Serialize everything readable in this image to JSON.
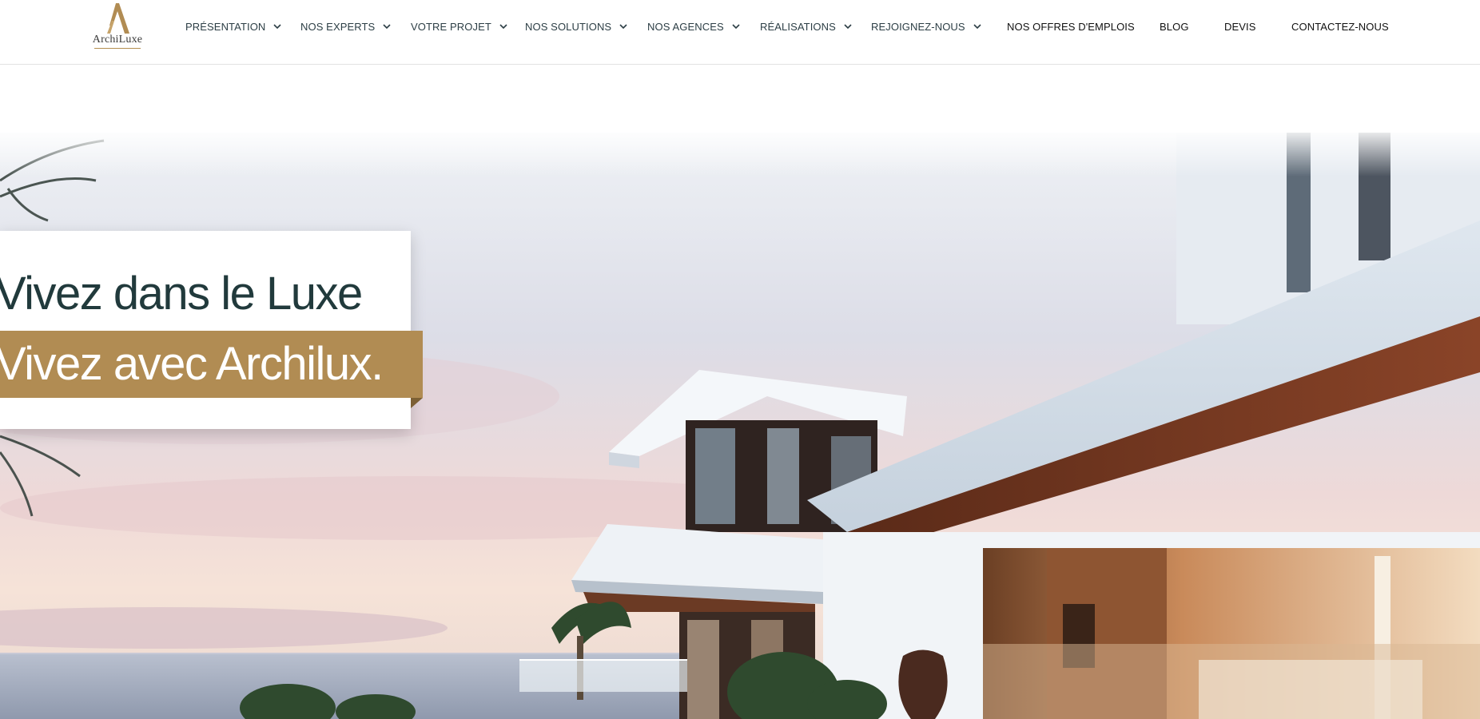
{
  "brand": {
    "name": "ArchiLuxe",
    "accent_color": "#b18c53",
    "text_color": "#213a3c"
  },
  "nav": {
    "items": [
      {
        "label": "PRÉSENTATION",
        "has_dropdown": true
      },
      {
        "label": "NOS EXPERTS",
        "has_dropdown": true
      },
      {
        "label": "VOTRE PROJET",
        "has_dropdown": true
      },
      {
        "label": "NOS SOLUTIONS",
        "has_dropdown": true
      },
      {
        "label": "NOS AGENCES",
        "has_dropdown": true
      },
      {
        "label": "RÉALISATIONS",
        "has_dropdown": true
      },
      {
        "label": "REJOIGNEZ-NOUS",
        "has_dropdown": true
      },
      {
        "label": "NOS OFFRES D'EMPLOIS",
        "has_dropdown": false
      },
      {
        "label": "BLOG",
        "has_dropdown": false
      },
      {
        "label": "DEVIS",
        "has_dropdown": false
      },
      {
        "label": "CONTACTEZ-NOUS",
        "has_dropdown": false
      }
    ],
    "dropdown_icon": "chevron-down-icon"
  },
  "hero": {
    "headline_line1": "Vivez dans le Luxe",
    "headline_line2": "Vivez avec Archilux.",
    "image_subject": "modern white luxury villa by the sea at sunset"
  }
}
